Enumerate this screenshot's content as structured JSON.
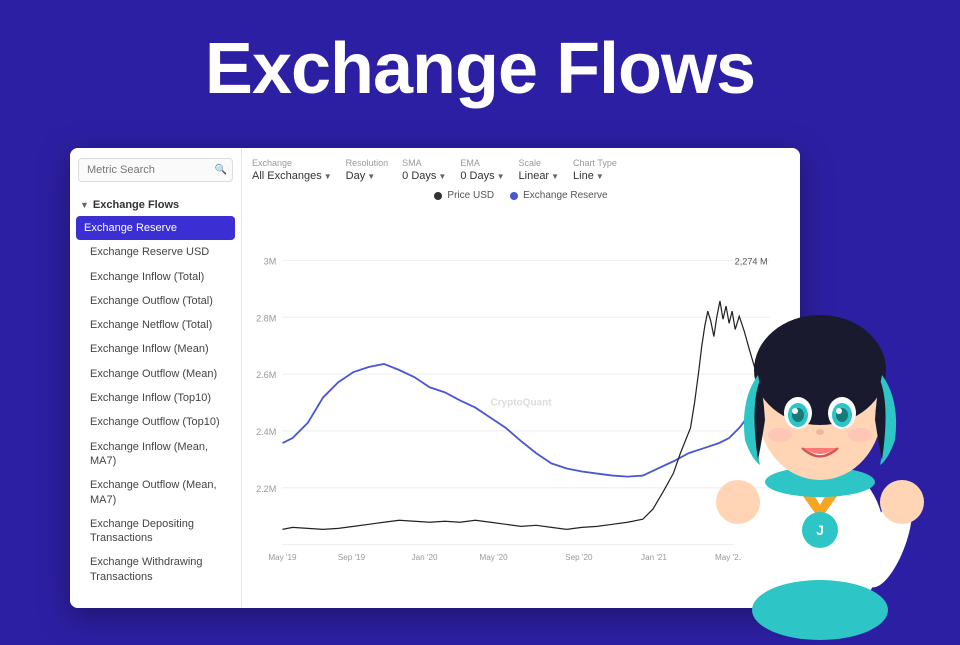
{
  "title": "Exchange Flows",
  "sidebar": {
    "search_placeholder": "Metric Search",
    "section_label": "Exchange Flows",
    "items": [
      {
        "label": "Exchange Reserve",
        "active": true
      },
      {
        "label": "Exchange Reserve USD",
        "active": false
      },
      {
        "label": "Exchange Inflow (Total)",
        "active": false
      },
      {
        "label": "Exchange Outflow (Total)",
        "active": false
      },
      {
        "label": "Exchange Netflow (Total)",
        "active": false
      },
      {
        "label": "Exchange Inflow (Mean)",
        "active": false
      },
      {
        "label": "Exchange Outflow (Mean)",
        "active": false
      },
      {
        "label": "Exchange Inflow (Top10)",
        "active": false
      },
      {
        "label": "Exchange Outflow (Top10)",
        "active": false
      },
      {
        "label": "Exchange Inflow (Mean, MA7)",
        "active": false
      },
      {
        "label": "Exchange Outflow (Mean, MA7)",
        "active": false
      },
      {
        "label": "Exchange Depositing Transactions",
        "active": false
      },
      {
        "label": "Exchange Withdrawing Transactions",
        "active": false
      }
    ]
  },
  "controls": {
    "exchange_label": "Exchange",
    "exchange_value": "All Exchanges",
    "resolution_label": "Resolution",
    "resolution_value": "Day",
    "sma_label": "SMA",
    "sma_value": "0 Days",
    "ema_label": "EMA",
    "ema_value": "0 Days",
    "scale_label": "Scale",
    "scale_value": "Linear",
    "chart_type_label": "Chart Type",
    "chart_type_value": "Line"
  },
  "legend": {
    "price_usd": "Price USD",
    "exchange_reserve": "Exchange Reserve"
  },
  "chart": {
    "watermark": "CryptoQuant",
    "y_labels": [
      "3M",
      "2.8M",
      "2.6M",
      "2.4M",
      "2.2M"
    ],
    "x_labels": [
      "May '19",
      "Sep '19",
      "Jan '20",
      "May '20",
      "Sep '20",
      "Jan '21",
      "May '21"
    ],
    "value_label": "2,274 M"
  },
  "colors": {
    "background": "#2d1fa3",
    "active_item": "#3b2fd4",
    "blue_line": "#4b56d2",
    "black_line": "#222222",
    "price_dot": "#333",
    "reserve_dot": "#4b56d2"
  }
}
